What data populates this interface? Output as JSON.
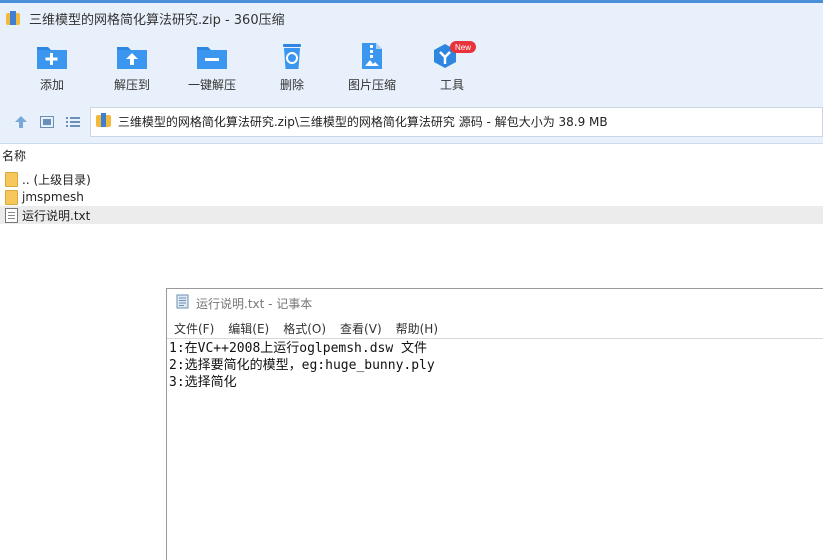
{
  "window": {
    "title": "三维模型的网格简化算法研究.zip - 360压缩"
  },
  "toolbar": {
    "items": [
      {
        "label": "添加",
        "icon": "add-icon"
      },
      {
        "label": "解压到",
        "icon": "extract-to-icon"
      },
      {
        "label": "一键解压",
        "icon": "one-click-extract-icon"
      },
      {
        "label": "删除",
        "icon": "delete-icon"
      },
      {
        "label": "图片压缩",
        "icon": "image-compress-icon"
      },
      {
        "label": "工具",
        "icon": "tools-icon",
        "badge": "New"
      }
    ]
  },
  "nav": {
    "path": "三维模型的网格简化算法研究.zip\\三维模型的网格简化算法研究 源码 - 解包大小为 38.9 MB"
  },
  "list": {
    "column_name": "名称",
    "rows": [
      {
        "name": ".. (上级目录)",
        "type": "folder"
      },
      {
        "name": "jmspmesh",
        "type": "folder"
      },
      {
        "name": "运行说明.txt",
        "type": "txt"
      }
    ]
  },
  "notepad": {
    "title": "运行说明.txt - 记事本",
    "menu": [
      "文件(F)",
      "编辑(E)",
      "格式(O)",
      "查看(V)",
      "帮助(H)"
    ],
    "lines": [
      "1:在VC++2008上运行oglpemsh.dsw 文件",
      "2:选择要简化的模型，eg:huge_bunny.ply",
      "3:选择简化"
    ]
  },
  "colors": {
    "accent": "#3a8ee6",
    "chrome": "#e8f1fb",
    "badge": "#e8333a"
  }
}
